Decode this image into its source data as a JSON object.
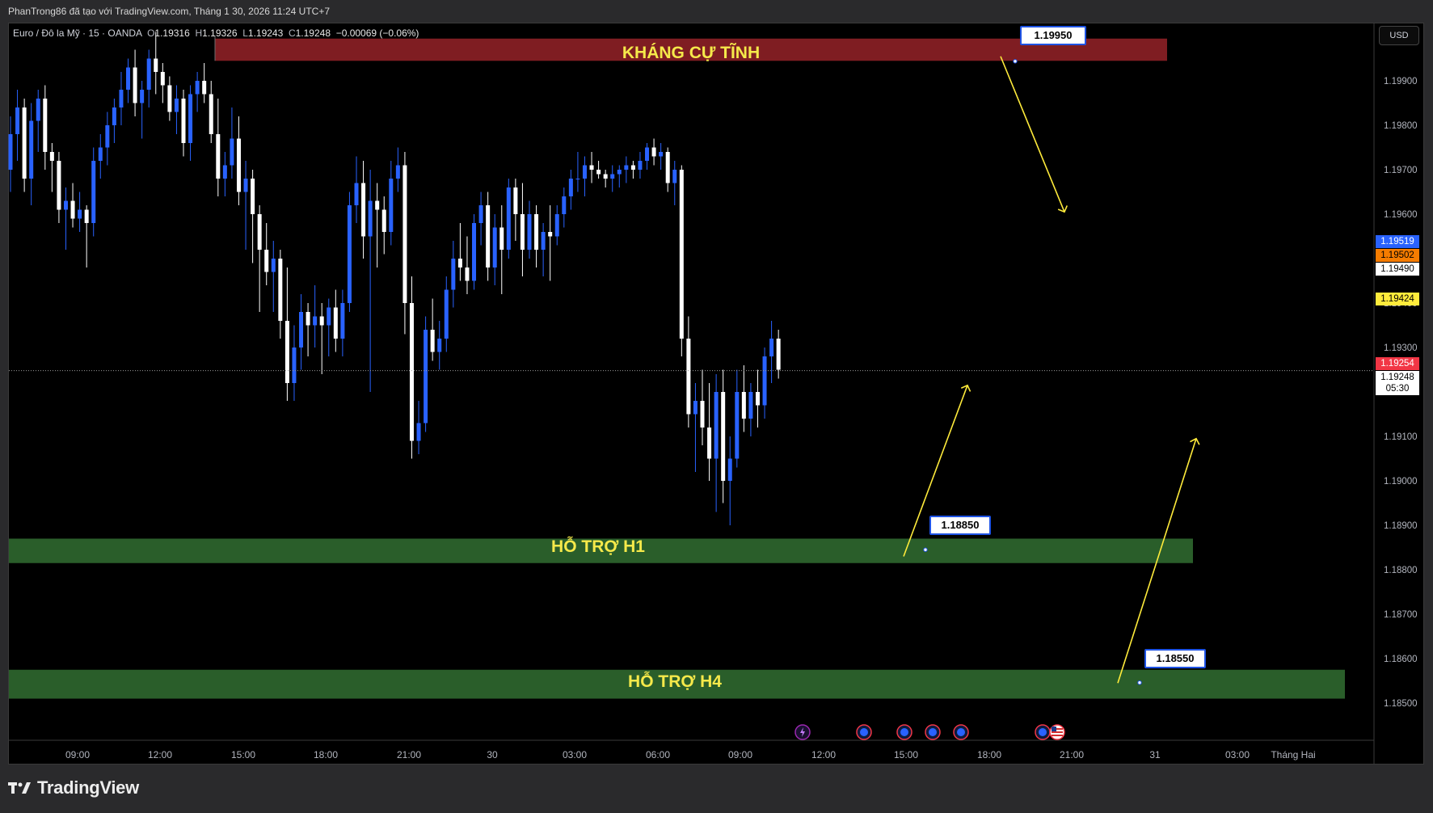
{
  "header": {
    "byline": "PhanTrong86 đã tạo với TradingView.com, Tháng 1 30, 2026 11:24 UTC+7"
  },
  "legend": {
    "symbol": "Euro / Đô la Mỹ · 15 · OANDA",
    "o_label": "O",
    "o": "1.19316",
    "h_label": "H",
    "h": "1.19326",
    "l_label": "L",
    "l": "1.19243",
    "c_label": "C",
    "c": "1.19248",
    "change": "−0.00069 (−0.06%)"
  },
  "currency_button": "USD",
  "price_axis": {
    "ticks": [
      "1.19900",
      "1.19800",
      "1.19700",
      "1.19600",
      "1.19400",
      "1.19300",
      "1.19200",
      "1.19100",
      "1.19000",
      "1.18900",
      "1.18800",
      "1.18700",
      "1.18600",
      "1.18500"
    ],
    "tags": [
      {
        "text": "1.19519",
        "bg": "#2962ff",
        "fg": "#ffffff"
      },
      {
        "text": "1.19502",
        "bg": "#f57c00",
        "fg": "#000000"
      },
      {
        "text": "1.19490",
        "bg": "#ffffff",
        "fg": "#000000"
      },
      {
        "text": "1.19424",
        "bg": "#ffeb3b",
        "fg": "#000000"
      },
      {
        "text": "1.19254",
        "bg": "#f23645",
        "fg": "#ffffff"
      },
      {
        "text": "1.19248",
        "bg": "#ffffff",
        "fg": "#000000"
      },
      {
        "text": "05:30",
        "bg": "#ffffff",
        "fg": "#000000"
      }
    ]
  },
  "time_axis": {
    "labels": [
      "09:00",
      "12:00",
      "15:00",
      "18:00",
      "21:00",
      "30",
      "03:00",
      "06:00",
      "09:00",
      "12:00",
      "15:00",
      "18:00",
      "21:00",
      "31",
      "03:00",
      "Tháng Hai"
    ]
  },
  "zones": {
    "resistance": {
      "label": "KHÁNG CỰ TĨNH",
      "color": "#7f1d22",
      "callout": "1.19950"
    },
    "support_h1": {
      "label": "HỖ TRỢ H1",
      "color": "#2a5e2a",
      "callout": "1.18850"
    },
    "support_h4": {
      "label": "HỖ TRỢ H4",
      "color": "#2a5e2a",
      "callout": "1.18550"
    }
  },
  "brand": {
    "name": "TradingView"
  },
  "colors": {
    "up": "#2962ff",
    "down": "#ffffff",
    "arrow": "#ffeb3b",
    "background": "#000000"
  },
  "event_icons": [
    "lightning-icon",
    "economic-event-icon",
    "economic-event-icon",
    "economic-event-icon",
    "economic-event-icon",
    "economic-event-icon",
    "us-flag-icon"
  ],
  "chart_data": {
    "type": "candlestick",
    "symbol": "EURUSD",
    "interval_minutes": 15,
    "ylim": [
      1.1845,
      1.2002
    ],
    "y_ticks": [
      1.199,
      1.198,
      1.197,
      1.196,
      1.194,
      1.193,
      1.192,
      1.191,
      1.19,
      1.189,
      1.188,
      1.187,
      1.186,
      1.185
    ],
    "last_price": 1.19248,
    "levels": [
      1.1995,
      1.1885,
      1.1855
    ],
    "candles": [
      [
        1.197,
        1.1982,
        1.1965,
        1.1978
      ],
      [
        1.1978,
        1.1988,
        1.1972,
        1.1984
      ],
      [
        1.1984,
        1.1986,
        1.1965,
        1.1968
      ],
      [
        1.1968,
        1.1985,
        1.1962,
        1.1981
      ],
      [
        1.1981,
        1.1988,
        1.1974,
        1.1986
      ],
      [
        1.1986,
        1.1989,
        1.197,
        1.1974
      ],
      [
        1.1974,
        1.1976,
        1.1965,
        1.1972
      ],
      [
        1.1972,
        1.1974,
        1.1958,
        1.1961
      ],
      [
        1.1961,
        1.1966,
        1.1952,
        1.1963
      ],
      [
        1.1963,
        1.1967,
        1.1957,
        1.1959
      ],
      [
        1.1959,
        1.1965,
        1.1956,
        1.1961
      ],
      [
        1.1961,
        1.1962,
        1.1948,
        1.1958
      ],
      [
        1.1958,
        1.1975,
        1.1955,
        1.1972
      ],
      [
        1.1972,
        1.1978,
        1.1968,
        1.1975
      ],
      [
        1.1975,
        1.1983,
        1.1971,
        1.198
      ],
      [
        1.198,
        1.1986,
        1.1976,
        1.1984
      ],
      [
        1.1984,
        1.1992,
        1.198,
        1.1988
      ],
      [
        1.1988,
        1.1995,
        1.1985,
        1.1993
      ],
      [
        1.1993,
        1.1997,
        1.1982,
        1.1985
      ],
      [
        1.1985,
        1.199,
        1.1977,
        1.1988
      ],
      [
        1.1988,
        1.1997,
        1.1984,
        1.1995
      ],
      [
        1.1995,
        1.2001,
        1.1987,
        1.1992
      ],
      [
        1.1992,
        1.1994,
        1.1985,
        1.1989
      ],
      [
        1.1989,
        1.1991,
        1.1981,
        1.1983
      ],
      [
        1.1983,
        1.1989,
        1.1978,
        1.1986
      ],
      [
        1.1986,
        1.1988,
        1.1973,
        1.1976
      ],
      [
        1.1976,
        1.1989,
        1.1972,
        1.1987
      ],
      [
        1.1987,
        1.1992,
        1.1983,
        1.199
      ],
      [
        1.199,
        1.1994,
        1.1985,
        1.1987
      ],
      [
        1.1987,
        1.199,
        1.1976,
        1.1978
      ],
      [
        1.1978,
        1.1986,
        1.1964,
        1.1968
      ],
      [
        1.1968,
        1.1974,
        1.1964,
        1.1971
      ],
      [
        1.1971,
        1.1984,
        1.1968,
        1.1977
      ],
      [
        1.1977,
        1.1982,
        1.1962,
        1.1965
      ],
      [
        1.1965,
        1.1972,
        1.1952,
        1.1968
      ],
      [
        1.1968,
        1.197,
        1.1949,
        1.196
      ],
      [
        1.196,
        1.1962,
        1.1938,
        1.1952
      ],
      [
        1.1952,
        1.1958,
        1.1944,
        1.1947
      ],
      [
        1.1947,
        1.1954,
        1.1938,
        1.195
      ],
      [
        1.195,
        1.1952,
        1.1932,
        1.1936
      ],
      [
        1.1936,
        1.1948,
        1.1918,
        1.1922
      ],
      [
        1.1922,
        1.1935,
        1.1918,
        1.193
      ],
      [
        1.193,
        1.1942,
        1.1925,
        1.1938
      ],
      [
        1.1938,
        1.194,
        1.1928,
        1.1935
      ],
      [
        1.1935,
        1.1944,
        1.193,
        1.1937
      ],
      [
        1.1937,
        1.194,
        1.1924,
        1.1935
      ],
      [
        1.1935,
        1.1941,
        1.1928,
        1.1939
      ],
      [
        1.1939,
        1.1943,
        1.1929,
        1.1932
      ],
      [
        1.1932,
        1.1943,
        1.1928,
        1.194
      ],
      [
        1.194,
        1.1965,
        1.1938,
        1.1962
      ],
      [
        1.1962,
        1.1973,
        1.1958,
        1.1967
      ],
      [
        1.1967,
        1.1972,
        1.195,
        1.1955
      ],
      [
        1.1955,
        1.197,
        1.192,
        1.1963
      ],
      [
        1.1963,
        1.1967,
        1.1948,
        1.1961
      ],
      [
        1.1961,
        1.1964,
        1.1951,
        1.1956
      ],
      [
        1.1956,
        1.1972,
        1.1953,
        1.1968
      ],
      [
        1.1968,
        1.1975,
        1.1965,
        1.1971
      ],
      [
        1.1971,
        1.1974,
        1.1933,
        1.194
      ],
      [
        1.194,
        1.1946,
        1.1905,
        1.1909
      ],
      [
        1.1909,
        1.1918,
        1.1906,
        1.1913
      ],
      [
        1.1913,
        1.1937,
        1.1911,
        1.1934
      ],
      [
        1.1934,
        1.1941,
        1.1927,
        1.1929
      ],
      [
        1.1929,
        1.1936,
        1.1925,
        1.1932
      ],
      [
        1.1932,
        1.1946,
        1.1929,
        1.1943
      ],
      [
        1.1943,
        1.1954,
        1.1939,
        1.195
      ],
      [
        1.195,
        1.1958,
        1.1945,
        1.1948
      ],
      [
        1.1948,
        1.1955,
        1.1942,
        1.1945
      ],
      [
        1.1945,
        1.196,
        1.1943,
        1.1958
      ],
      [
        1.1958,
        1.1965,
        1.1953,
        1.1962
      ],
      [
        1.1962,
        1.1965,
        1.1945,
        1.1948
      ],
      [
        1.1948,
        1.196,
        1.1944,
        1.1957
      ],
      [
        1.1957,
        1.1962,
        1.1942,
        1.1952
      ],
      [
        1.1952,
        1.1968,
        1.195,
        1.1966
      ],
      [
        1.1966,
        1.1968,
        1.1954,
        1.196
      ],
      [
        1.196,
        1.1967,
        1.1946,
        1.1952
      ],
      [
        1.1952,
        1.1963,
        1.195,
        1.196
      ],
      [
        1.196,
        1.1962,
        1.1948,
        1.1952
      ],
      [
        1.1952,
        1.1958,
        1.1946,
        1.1956
      ],
      [
        1.1956,
        1.1962,
        1.1945,
        1.1955
      ],
      [
        1.1955,
        1.1962,
        1.1953,
        1.196
      ],
      [
        1.196,
        1.1966,
        1.1957,
        1.1964
      ],
      [
        1.1964,
        1.197,
        1.1961,
        1.1968
      ],
      [
        1.1968,
        1.1974,
        1.1965,
        1.1968
      ],
      [
        1.1968,
        1.1973,
        1.1964,
        1.1971
      ],
      [
        1.1971,
        1.1974,
        1.1967,
        1.197
      ],
      [
        1.197,
        1.1972,
        1.1968,
        1.1969
      ],
      [
        1.1969,
        1.197,
        1.1966,
        1.1968
      ],
      [
        1.1968,
        1.1971,
        1.1965,
        1.1969
      ],
      [
        1.1969,
        1.1971,
        1.1966,
        1.197
      ],
      [
        1.197,
        1.1973,
        1.1967,
        1.1971
      ],
      [
        1.1971,
        1.1972,
        1.1968,
        1.197
      ],
      [
        1.197,
        1.1974,
        1.1968,
        1.1972
      ],
      [
        1.1972,
        1.1976,
        1.197,
        1.1975
      ],
      [
        1.1975,
        1.1977,
        1.1971,
        1.1973
      ],
      [
        1.1973,
        1.1976,
        1.197,
        1.1974
      ],
      [
        1.1974,
        1.1975,
        1.1965,
        1.1967
      ],
      [
        1.1967,
        1.1972,
        1.1962,
        1.197
      ],
      [
        1.197,
        1.1971,
        1.1928,
        1.1932
      ],
      [
        1.1932,
        1.1937,
        1.1912,
        1.1915
      ],
      [
        1.1915,
        1.1922,
        1.1902,
        1.1918
      ],
      [
        1.1918,
        1.1925,
        1.1908,
        1.1912
      ],
      [
        1.1912,
        1.1922,
        1.19,
        1.1905
      ],
      [
        1.1905,
        1.1924,
        1.1893,
        1.192
      ],
      [
        1.192,
        1.1925,
        1.1895,
        1.19
      ],
      [
        1.19,
        1.191,
        1.189,
        1.1905
      ],
      [
        1.1905,
        1.1925,
        1.1903,
        1.192
      ],
      [
        1.192,
        1.1926,
        1.1911,
        1.1914
      ],
      [
        1.1914,
        1.1922,
        1.191,
        1.192
      ],
      [
        1.192,
        1.1925,
        1.1912,
        1.1917
      ],
      [
        1.1917,
        1.193,
        1.1914,
        1.1928
      ],
      [
        1.1928,
        1.1936,
        1.1922,
        1.1932
      ],
      [
        1.1932,
        1.1934,
        1.1923,
        1.1925
      ]
    ]
  }
}
